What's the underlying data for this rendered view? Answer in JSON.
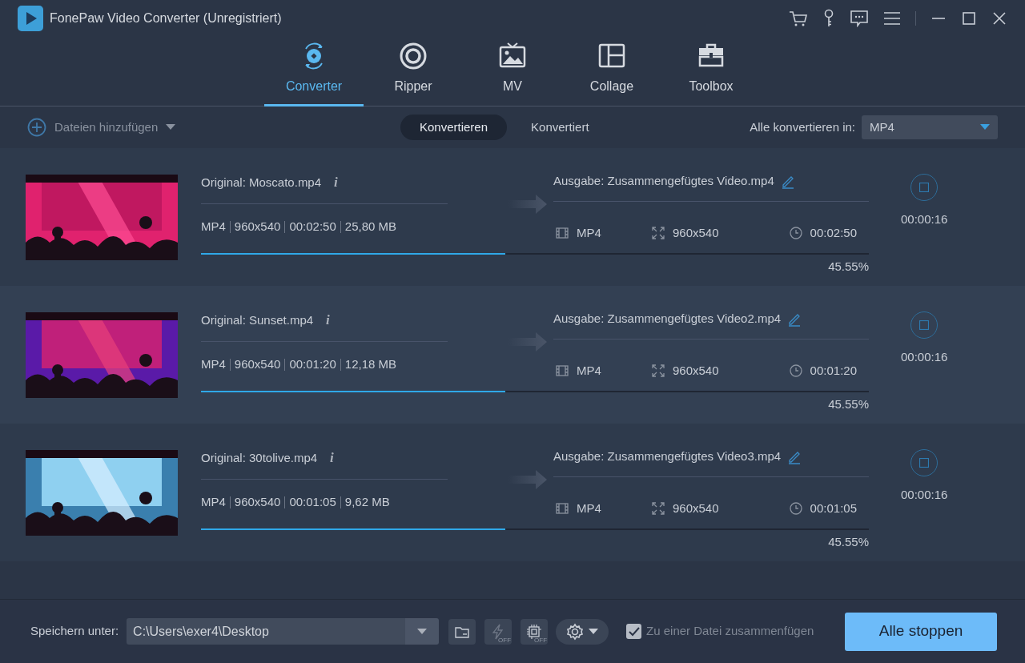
{
  "window": {
    "title": "FonePaw Video Converter (Unregistriert)"
  },
  "tabs": [
    {
      "label": "Converter",
      "selected": true
    },
    {
      "label": "Ripper",
      "selected": false
    },
    {
      "label": "MV",
      "selected": false
    },
    {
      "label": "Collage",
      "selected": false
    },
    {
      "label": "Toolbox",
      "selected": false
    }
  ],
  "toolbar": {
    "add_files": "Dateien hinzufügen",
    "segments": [
      {
        "label": "Konvertieren",
        "selected": true
      },
      {
        "label": "Konvertiert",
        "selected": false
      }
    ],
    "convert_all_label": "Alle konvertieren in:",
    "convert_all_value": "MP4"
  },
  "files": [
    {
      "original": "Original: Moscato.mp4",
      "info": "i",
      "meta": [
        "MP4",
        "960x540",
        "00:02:50",
        "25,80 MB"
      ],
      "output": "Ausgabe: Zusammengefügtes Video.mp4",
      "out_format": "MP4",
      "out_resolution": "960x540",
      "out_duration": "00:02:50",
      "level": 0.4555,
      "percent": "45.55%",
      "elapsed": "00:00:16"
    },
    {
      "original": "Original: Sunset.mp4",
      "info": "i",
      "meta": [
        "MP4",
        "960x540",
        "00:01:20",
        "12,18 MB"
      ],
      "output": "Ausgabe: Zusammengefügtes Video2.mp4",
      "out_format": "MP4",
      "out_resolution": "960x540",
      "out_duration": "00:01:20",
      "level": 0.4555,
      "percent": "45.55%",
      "elapsed": "00:00:16"
    },
    {
      "original": "Original: 30tolive.mp4",
      "info": "i",
      "meta": [
        "MP4",
        "960x540",
        "00:01:05",
        "9,62 MB"
      ],
      "output": "Ausgabe: Zusammengefügtes Video3.mp4",
      "out_format": "MP4",
      "out_resolution": "960x540",
      "out_duration": "00:01:05",
      "level": 0.4555,
      "percent": "45.55%",
      "elapsed": "00:00:16"
    }
  ],
  "footer": {
    "save_label": "Speichern unter:",
    "save_path": "C:\\Users\\exer4\\Desktop",
    "tool_badges": [
      "OFF",
      "OFF"
    ],
    "merge": {
      "label": "Zu einer Datei zusammenfügen",
      "checked": true
    },
    "stop_button": "Alle stoppen"
  }
}
